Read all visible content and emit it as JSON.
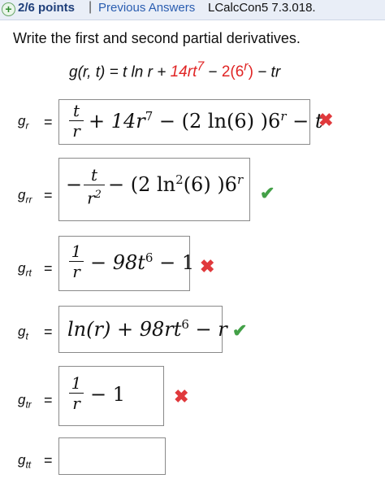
{
  "header": {
    "points": "2/6 points",
    "separator": "|",
    "previous_answers": "Previous Answers",
    "problem_code": "LCalcCon5 7.3.018."
  },
  "question": {
    "instruction": "Write the first and second partial derivatives.",
    "function_lhs": "g(r, t) = t ln r + ",
    "function_red1": "14rt",
    "function_red1_exp": "7",
    "function_mid": " − ",
    "function_red2": "2(6",
    "function_red2_exp": "r",
    "function_red2_close": ")",
    "function_tail": " − tr"
  },
  "answers": [
    {
      "label_base": "g",
      "label_sub": "r",
      "status": "incorrect"
    },
    {
      "label_base": "g",
      "label_sub": "rr",
      "status": "correct"
    },
    {
      "label_base": "g",
      "label_sub": "rt",
      "status": "incorrect"
    },
    {
      "label_base": "g",
      "label_sub": "t",
      "status": "correct"
    },
    {
      "label_base": "g",
      "label_sub": "tr",
      "status": "incorrect"
    },
    {
      "label_base": "g",
      "label_sub": "tt",
      "status": "empty"
    }
  ],
  "math": {
    "gr": {
      "num": "t",
      "den": "r",
      "rest": "+ 14r",
      "rest_exp": "7",
      "rest2": " − (2 ln(6) )6",
      "rest2_exp": "r",
      "rest3": " − t"
    },
    "grr": {
      "minus": "−",
      "num": "t",
      "den": "r",
      "den_exp": "2",
      "rest": "− (2 ln",
      "rest_exp": "2",
      "rest2": "(6) )6",
      "rest2_exp": "r"
    },
    "grt": {
      "num": "1",
      "den": "r",
      "rest": "− 98t",
      "rest_exp": "6",
      "rest2": " − 1"
    },
    "gt": {
      "text": "ln(r) + 98rt",
      "exp": "6",
      "tail": " − r"
    },
    "gtr": {
      "num": "1",
      "den": "r",
      "rest": "− 1"
    }
  },
  "equals": "=",
  "icons": {
    "incorrect": "✖",
    "correct": "✔"
  },
  "colors": {
    "incorrect": "#e0393c",
    "correct": "#43a047",
    "highlight": "#e02525",
    "link": "#2a5db0"
  }
}
